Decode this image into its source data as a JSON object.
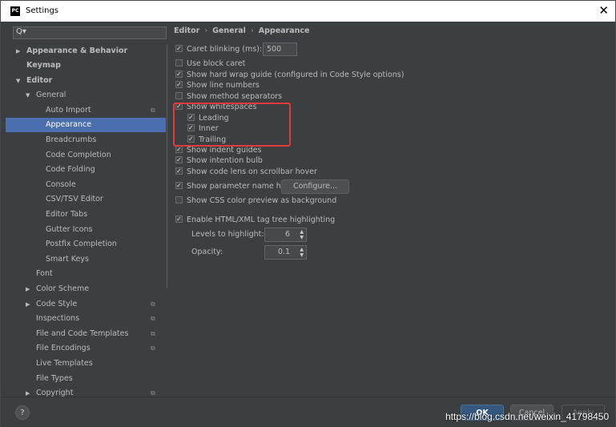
{
  "window": {
    "title": "Settings",
    "app_icon": "PC"
  },
  "search": {
    "placeholder": ""
  },
  "sidebar": {
    "items": [
      {
        "label": "Appearance & Behavior",
        "arrow": "▶"
      },
      {
        "label": "Keymap"
      },
      {
        "label": "Editor",
        "arrow": "▼"
      },
      {
        "label": "General",
        "arrow": "▼"
      },
      {
        "label": "Auto Import",
        "copy": "⧉"
      },
      {
        "label": "Appearance"
      },
      {
        "label": "Breadcrumbs"
      },
      {
        "label": "Code Completion"
      },
      {
        "label": "Code Folding"
      },
      {
        "label": "Console"
      },
      {
        "label": "CSV/TSV Editor"
      },
      {
        "label": "Editor Tabs"
      },
      {
        "label": "Gutter Icons"
      },
      {
        "label": "Postfix Completion"
      },
      {
        "label": "Smart Keys"
      },
      {
        "label": "Font"
      },
      {
        "label": "Color Scheme",
        "arrow": "▶"
      },
      {
        "label": "Code Style",
        "arrow": "▶",
        "copy": "⧉"
      },
      {
        "label": "Inspections",
        "copy": "⧉"
      },
      {
        "label": "File and Code Templates",
        "copy": "⧉"
      },
      {
        "label": "File Encodings",
        "copy": "⧉"
      },
      {
        "label": "Live Templates"
      },
      {
        "label": "File Types"
      },
      {
        "label": "Copyright",
        "arrow": "▶",
        "copy": "⧉"
      }
    ]
  },
  "breadcrumb": {
    "part1": "Editor",
    "part2": "General",
    "part3": "Appearance",
    "sep": "›"
  },
  "options": {
    "caret_blinking": {
      "label": "Caret blinking (ms):",
      "value": "500",
      "checked": true
    },
    "block_caret": {
      "label": "Use block caret",
      "checked": false
    },
    "hard_wrap": {
      "label": "Show hard wrap guide (configured in Code Style options)",
      "checked": true
    },
    "line_numbers": {
      "label": "Show line numbers",
      "checked": true
    },
    "method_separators": {
      "label": "Show method separators",
      "checked": false
    },
    "whitespaces": {
      "label": "Show whitespaces",
      "checked": true
    },
    "leading": {
      "label": "Leading",
      "checked": true
    },
    "inner": {
      "label": "Inner",
      "checked": true
    },
    "trailing": {
      "label": "Trailing",
      "checked": true
    },
    "indent_guides": {
      "label": "Show indent guides",
      "checked": true
    },
    "intention_bulb": {
      "label": "Show intention bulb",
      "checked": true
    },
    "code_lens": {
      "label": "Show code lens on scrollbar hover",
      "checked": true
    },
    "param_hints": {
      "label": "Show parameter name hints",
      "checked": true
    },
    "configure_button": "Configure...",
    "css_preview": {
      "label": "Show CSS color preview as background",
      "checked": false
    },
    "html_tag_tree": {
      "label": "Enable HTML/XML tag tree highlighting",
      "checked": true
    },
    "levels": {
      "label": "Levels to highlight:",
      "value": "6"
    },
    "opacity": {
      "label": "Opacity:",
      "value": "0.1"
    }
  },
  "footer": {
    "help": "?",
    "ok": "OK",
    "cancel": "Cancel",
    "apply": "Apply"
  },
  "watermark": "https://blog.csdn.net/weixin_41798450",
  "colors": {
    "selection": "#4b6eaf",
    "highlight_box": "#e23a3a",
    "ok_button": "#365880"
  }
}
